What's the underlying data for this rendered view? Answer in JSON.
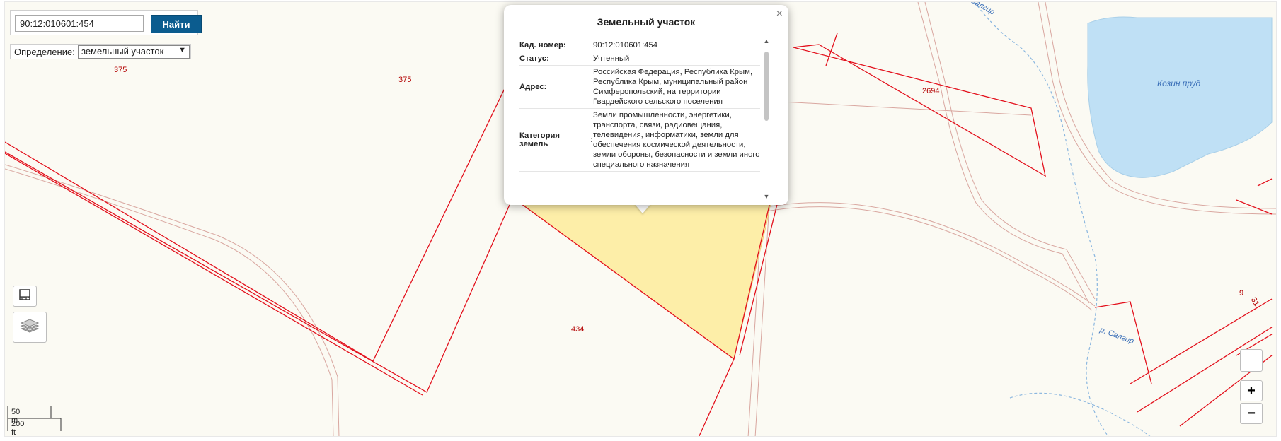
{
  "search": {
    "value": "90:12:010601:454",
    "button_label": "Найти"
  },
  "definition": {
    "label": "Определение:",
    "selected": "земельный участок"
  },
  "map_labels": {
    "l375a": "375",
    "l375b": "375",
    "l2694": "2694",
    "l434": "434",
    "l9": "9",
    "l31": "31"
  },
  "map_texts": {
    "pond": "Козин пруд",
    "river_top": "Салгир",
    "river_bottom": "р. Салгир"
  },
  "scale": {
    "metric": "50 m",
    "imperial": "200 ft"
  },
  "zoom": {
    "in": "+",
    "out": "−"
  },
  "popup": {
    "title": "Земельный участок",
    "close": "×",
    "rows": [
      {
        "key": "Кад. номер",
        "value": "90:12:010601:454"
      },
      {
        "key": "Статус",
        "value": "Учтенный"
      },
      {
        "key": "Адрес",
        "value": "Российская Федерация, Республика Крым, Республика Крым, муниципальный район Симферопольский, на территории Гвардейского сельского поселения"
      },
      {
        "key": "Категория земель",
        "value": "Земли промышленности, энергетики, транспорта, связи, радиовещания, телевидения, информатики, земли для обеспечения космической деятельности, земли обороны, безопасности и земли иного специального назначения"
      }
    ]
  },
  "colors": {
    "boundary": "#e3101c",
    "road": "#d9a7a0",
    "pond": "#bfe0f5",
    "highlight": "#fdeea8",
    "button": "#0b5c8f"
  },
  "icons": {
    "ruler": "ruler-icon",
    "layers": "layers-icon"
  }
}
